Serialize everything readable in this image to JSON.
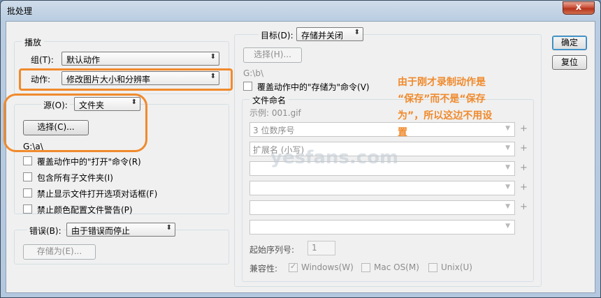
{
  "window": {
    "title": "批处理",
    "close_label": "x"
  },
  "play": {
    "legend": "播放",
    "set_label": "组(T):",
    "set_value": "默认动作",
    "action_label": "动作:",
    "action_value": "修改图片大小和分辨率"
  },
  "source": {
    "label": "源(O):",
    "value": "文件夹",
    "choose_button": "选择(C)...",
    "path": "G:\\a\\",
    "checkboxes": [
      {
        "label": "覆盖动作中的\"打开\"命令(R)",
        "checked": false
      },
      {
        "label": "包含所有子文件夹(I)",
        "checked": false
      },
      {
        "label": "禁止显示文件打开选项对话框(F)",
        "checked": false
      },
      {
        "label": "禁止颜色配置文件警告(P)",
        "checked": false
      }
    ]
  },
  "errors": {
    "label": "错误(B):",
    "value": "由于错误而停止",
    "save_as_button": "存储为(E)..."
  },
  "destination": {
    "label": "目标(D):",
    "value": "存储并关闭",
    "choose_button": "选择(H)...",
    "path": "G:\\b\\",
    "override_label": "覆盖动作中的\"存储为\"命令(V)"
  },
  "naming": {
    "legend": "文件命名",
    "example": "示例: 001.gif",
    "fields": [
      "3 位数序号",
      "扩展名 (小写)",
      "",
      "",
      "",
      ""
    ],
    "start_serial_label": "起始序列号:",
    "start_serial_value": "1",
    "compat_label": "兼容性:",
    "compat": [
      {
        "label": "Windows(W)",
        "checked": true
      },
      {
        "label": "Mac OS(M)",
        "checked": false
      },
      {
        "label": "Unix(U)",
        "checked": false
      }
    ]
  },
  "buttons": {
    "ok": "确定",
    "reset": "复位"
  },
  "annotation": {
    "line1": "由于刚才录制动作是",
    "line2": "“保存”而不是“保存",
    "line3": "为”，所以这边不用设",
    "line4": "置"
  },
  "watermark": {
    "text": "yesfans.com"
  },
  "colors": {
    "highlight": "#f08a2c",
    "annotation": "#f08a2c"
  }
}
